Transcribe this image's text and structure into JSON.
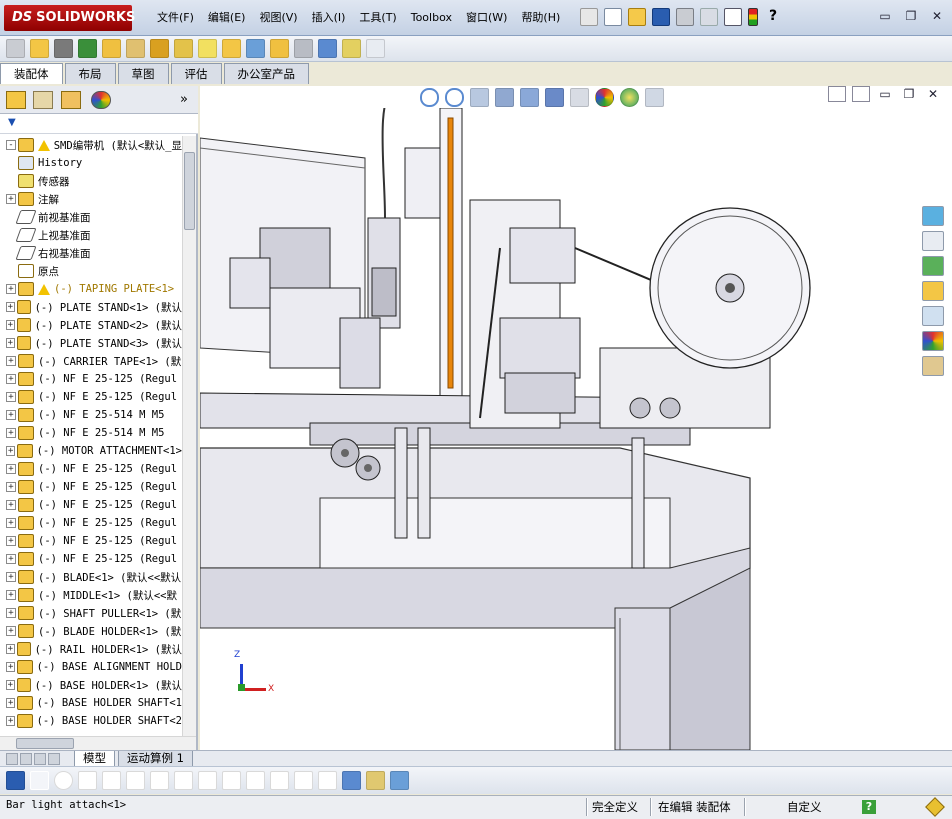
{
  "app": {
    "logo_prefix": "DS",
    "logo_name": "SOLIDWORKS"
  },
  "menu": [
    "文件(F)",
    "编辑(E)",
    "视图(V)",
    "插入(I)",
    "工具(T)",
    "Toolbox",
    "窗口(W)",
    "帮助(H)"
  ],
  "window_controls": {
    "minimize": "▭",
    "restore": "❐",
    "close": "✕",
    "help": "?"
  },
  "command_tabs": [
    "装配体",
    "布局",
    "草图",
    "评估",
    "办公室产品"
  ],
  "panel": {
    "expand_glyph": "»",
    "filter_glyph": "▼"
  },
  "tree": [
    {
      "label": "SMD编带机  (默认<默认_显",
      "expand": "-",
      "icon": "assembly",
      "warn": true,
      "indent": 0
    },
    {
      "label": "History",
      "expand": "",
      "icon": "history",
      "warn": false,
      "indent": 1
    },
    {
      "label": "传感器",
      "expand": "",
      "icon": "sensor",
      "warn": false,
      "indent": 1
    },
    {
      "label": "注解",
      "expand": "+",
      "icon": "annotation",
      "warn": false,
      "indent": 1
    },
    {
      "label": "前视基准面",
      "expand": "",
      "icon": "plane",
      "warn": false,
      "indent": 1
    },
    {
      "label": "上视基准面",
      "expand": "",
      "icon": "plane",
      "warn": false,
      "indent": 1
    },
    {
      "label": "右视基准面",
      "expand": "",
      "icon": "plane",
      "warn": false,
      "indent": 1
    },
    {
      "label": "原点",
      "expand": "",
      "icon": "origin",
      "warn": false,
      "indent": 1
    },
    {
      "label": "(-) TAPING PLATE<1>",
      "expand": "+",
      "icon": "part",
      "warn": true,
      "indent": 1
    },
    {
      "label": "(-) PLATE STAND<1> (默认",
      "expand": "+",
      "icon": "part",
      "warn": false,
      "indent": 1
    },
    {
      "label": "(-) PLATE STAND<2> (默认",
      "expand": "+",
      "icon": "part",
      "warn": false,
      "indent": 1
    },
    {
      "label": "(-) PLATE STAND<3> (默认",
      "expand": "+",
      "icon": "part",
      "warn": false,
      "indent": 1
    },
    {
      "label": "(-) CARRIER TAPE<1> (默",
      "expand": "+",
      "icon": "part",
      "warn": false,
      "indent": 1
    },
    {
      "label": "(-) NF E 25-125  (Regul",
      "expand": "+",
      "icon": "part",
      "warn": false,
      "indent": 1
    },
    {
      "label": "(-) NF E 25-125  (Regul",
      "expand": "+",
      "icon": "part",
      "warn": false,
      "indent": 1
    },
    {
      "label": "(-) NF E 25-514  M M5",
      "expand": "+",
      "icon": "part",
      "warn": false,
      "indent": 1
    },
    {
      "label": "(-) NF E 25-514  M M5",
      "expand": "+",
      "icon": "part",
      "warn": false,
      "indent": 1
    },
    {
      "label": "(-) MOTOR ATTACHMENT<1>",
      "expand": "+",
      "icon": "part",
      "warn": false,
      "indent": 1
    },
    {
      "label": "(-) NF E 25-125  (Regul",
      "expand": "+",
      "icon": "part",
      "warn": false,
      "indent": 1
    },
    {
      "label": "(-) NF E 25-125  (Regul",
      "expand": "+",
      "icon": "part",
      "warn": false,
      "indent": 1
    },
    {
      "label": "(-) NF E 25-125  (Regul",
      "expand": "+",
      "icon": "part",
      "warn": false,
      "indent": 1
    },
    {
      "label": "(-) NF E 25-125  (Regul",
      "expand": "+",
      "icon": "part",
      "warn": false,
      "indent": 1
    },
    {
      "label": "(-) NF E 25-125  (Regul",
      "expand": "+",
      "icon": "part",
      "warn": false,
      "indent": 1
    },
    {
      "label": "(-) NF E 25-125  (Regul",
      "expand": "+",
      "icon": "part",
      "warn": false,
      "indent": 1
    },
    {
      "label": "(-) BLADE<1> (默认<<默认",
      "expand": "+",
      "icon": "part",
      "warn": false,
      "indent": 1
    },
    {
      "label": "(-) MIDDLE<1> (默认<<默",
      "expand": "+",
      "icon": "part",
      "warn": false,
      "indent": 1
    },
    {
      "label": "(-) SHAFT PULLER<1> (默",
      "expand": "+",
      "icon": "part",
      "warn": false,
      "indent": 1
    },
    {
      "label": "(-) BLADE HOLDER<1> (默",
      "expand": "+",
      "icon": "part",
      "warn": false,
      "indent": 1
    },
    {
      "label": "(-) RAIL HOLDER<1> (默认",
      "expand": "+",
      "icon": "part",
      "warn": false,
      "indent": 1
    },
    {
      "label": "(-) BASE ALIGNMENT HOLD",
      "expand": "+",
      "icon": "part",
      "warn": false,
      "indent": 1
    },
    {
      "label": "(-) BASE HOLDER<1> (默认",
      "expand": "+",
      "icon": "part",
      "warn": false,
      "indent": 1
    },
    {
      "label": "(-) BASE HOLDER SHAFT<1",
      "expand": "+",
      "icon": "part",
      "warn": false,
      "indent": 1
    },
    {
      "label": "(-) BASE HOLDER SHAFT<2",
      "expand": "+",
      "icon": "part",
      "warn": false,
      "indent": 1
    }
  ],
  "triad": {
    "x": "X",
    "z": "Z"
  },
  "model_tabs": [
    "模型",
    "运动算例 1"
  ],
  "status": {
    "message": "Bar light attach<1>",
    "defined": "完全定义",
    "editing": "在编辑 装配体",
    "custom": "自定义",
    "help_glyph": "?"
  },
  "colors": {
    "brand_red": "#b3121a",
    "toolbar_bg": "#dde3ec",
    "rail_orange": "#e8860c"
  }
}
